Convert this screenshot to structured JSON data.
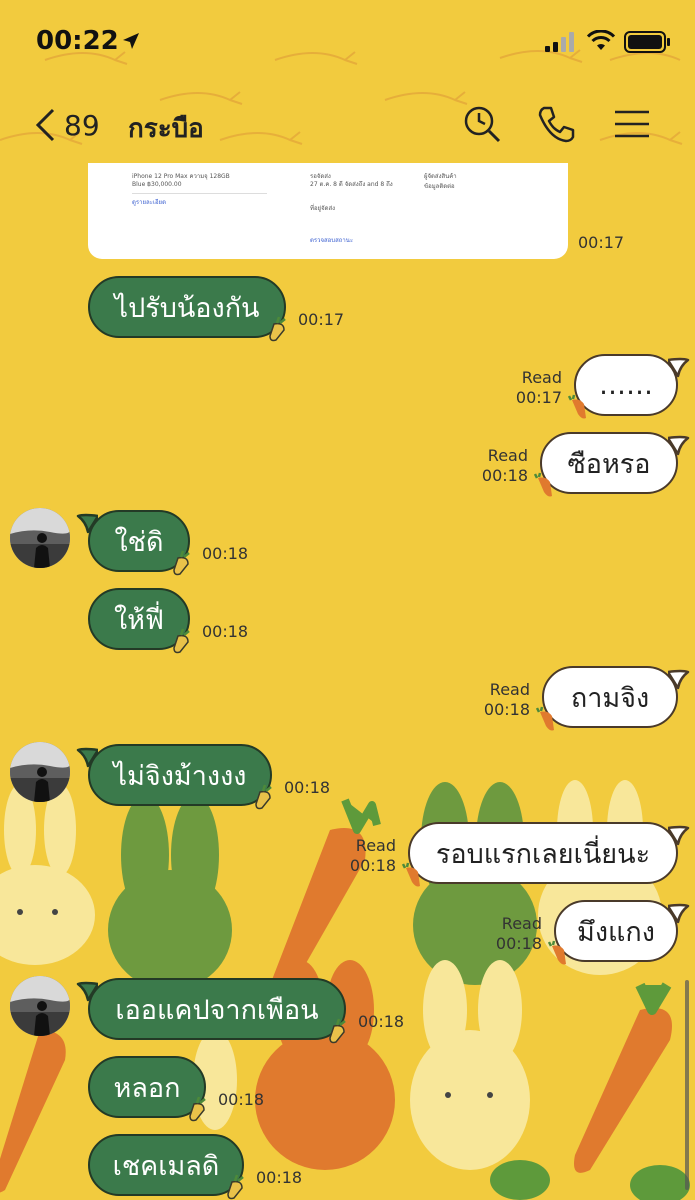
{
  "status_bar": {
    "time": "00:22"
  },
  "header": {
    "back_count": "89",
    "title": "กระบือ"
  },
  "shared_card": {
    "lines": [
      "iPhone 12 Pro Max ความจุ 128GB",
      "Blue ฿30,000.00",
      "ดูรายละเอียด",
      "รอจัดส่ง",
      "27 ต.ค. 8 ดี จัดส่งถึง and 8 ถึง",
      "ที่อยู่จัดส่ง",
      "ตรวจสอบสถานะ",
      "ผู้จัดส่งสินค้า",
      "ข้อมูลติดต่อ"
    ],
    "time": "00:17"
  },
  "messages": [
    {
      "dir": "in",
      "text": "ไปรับน้องกัน",
      "time": "00:17"
    },
    {
      "dir": "out",
      "text": "……",
      "read": "Read",
      "time": "00:17"
    },
    {
      "dir": "out",
      "text": "ซือหรอ",
      "read": "Read",
      "time": "00:18"
    },
    {
      "dir": "in",
      "text": "ใช่ดิ",
      "time": "00:18"
    },
    {
      "dir": "in",
      "text": "ให้ฟี่",
      "time": "00:18"
    },
    {
      "dir": "out",
      "text": "ถามจิง",
      "read": "Read",
      "time": "00:18"
    },
    {
      "dir": "in",
      "text": "ไม่จิงม้างงง",
      "time": "00:18"
    },
    {
      "dir": "out",
      "text": "รอบแรกเลยเนี่ยนะ",
      "read": "Read",
      "time": "00:18"
    },
    {
      "dir": "out",
      "text": "มึงแกง",
      "read": "Read",
      "time": "00:18"
    },
    {
      "dir": "in",
      "text": "เออแคปจากเพือน",
      "time": "00:18"
    },
    {
      "dir": "in",
      "text": "หลอก",
      "time": "00:18"
    },
    {
      "dir": "in",
      "text": "เชคเมลดิ",
      "time": "00:18"
    }
  ],
  "colors": {
    "background": "#F2CB3E",
    "incoming_bubble": "#3B7A4B",
    "outgoing_bubble": "#FFFFFF",
    "carrot": "#E07A2E"
  },
  "icons": {
    "back": "chevron-left-icon",
    "search": "search-icon",
    "call": "phone-icon",
    "menu": "menu-icon"
  }
}
